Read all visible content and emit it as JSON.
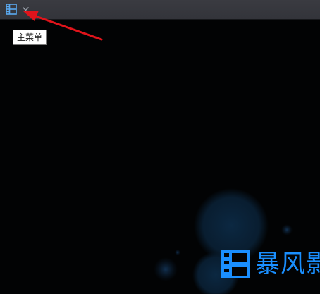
{
  "titlebar": {
    "menu_icon": "film-grid-icon",
    "dropdown_icon": "chevron-down-icon"
  },
  "tooltip": {
    "text": "主菜单"
  },
  "annotation": {
    "arrow_color": "#e0141b"
  },
  "brand": {
    "logo_icon": "film-grid-icon",
    "name": "暴风影",
    "color": "#1a8fff"
  },
  "colors": {
    "titlebar": "#36373d",
    "background": "#020304",
    "accent": "#3c8fe0"
  }
}
